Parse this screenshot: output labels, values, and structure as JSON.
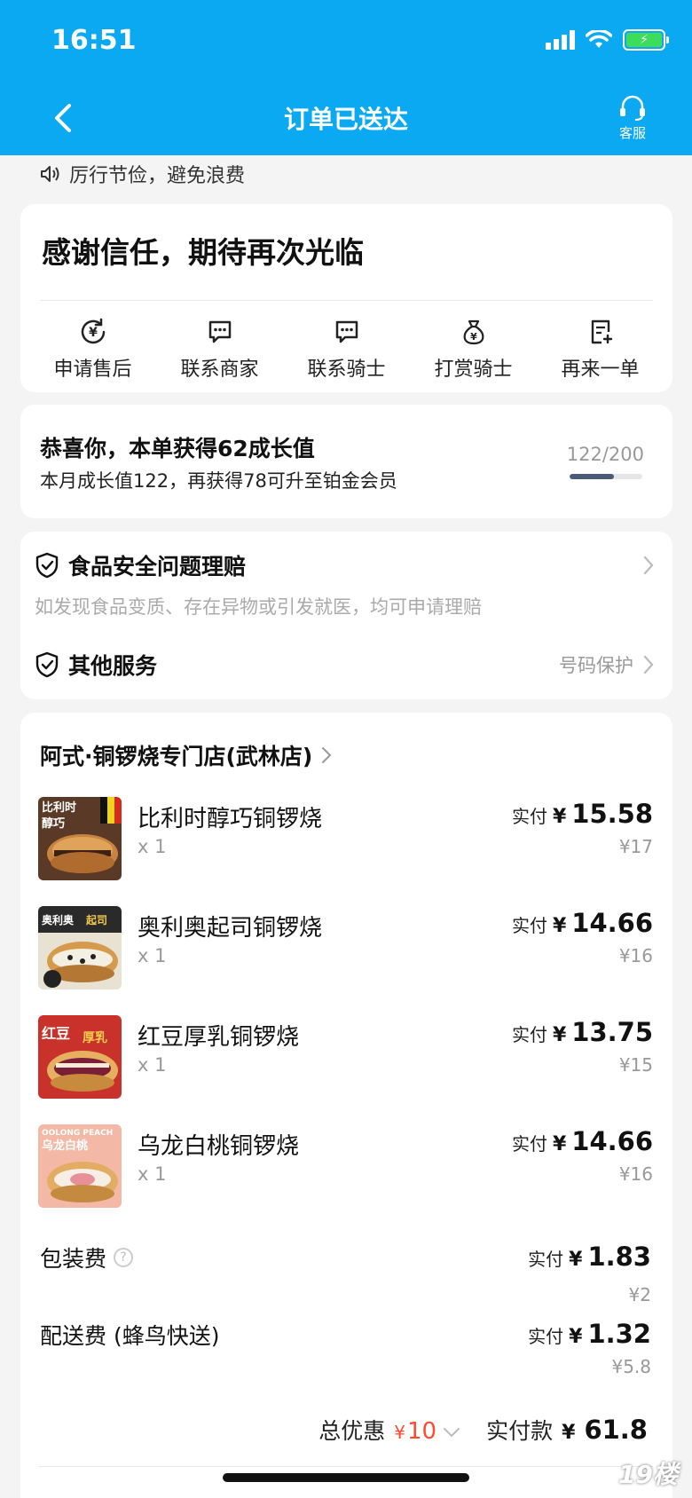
{
  "status_bar": {
    "time": "16:51"
  },
  "nav": {
    "title": "订单已送达",
    "service_label": "客服"
  },
  "notice": "厉行节俭，避免浪费",
  "thanks_card": {
    "title": "感谢信任，期待再次光临",
    "actions": [
      {
        "label": "申请售后",
        "icon": "refund-icon"
      },
      {
        "label": "联系商家",
        "icon": "chat-icon"
      },
      {
        "label": "联系骑士",
        "icon": "chat-icon"
      },
      {
        "label": "打赏骑士",
        "icon": "money-bag-icon"
      },
      {
        "label": "再来一单",
        "icon": "reorder-icon"
      }
    ]
  },
  "growth": {
    "title": "恭喜你，本单获得62成长值",
    "subtitle": "本月成长值122，再获得78可升至铂金会员",
    "progress_text": "122/200",
    "progress_fraction": 0.61
  },
  "services": {
    "food_safety": {
      "title": "食品安全问题理赔",
      "desc": "如发现食品变质、存在异物或引发就医，均可申请理赔"
    },
    "other": {
      "title": "其他服务",
      "right": "号码保护"
    }
  },
  "order": {
    "shop_name": "阿式·铜锣烧专门店(武林店)",
    "paid_label": "实付",
    "currency": "¥",
    "items": [
      {
        "name": "比利时醇巧铜锣烧",
        "qty": "x 1",
        "paid": "15.58",
        "orig": "¥17",
        "thumb_text": "比利时醇巧"
      },
      {
        "name": "奥利奥起司铜锣烧",
        "qty": "x 1",
        "paid": "14.66",
        "orig": "¥16",
        "thumb_text": "奥利奥起司"
      },
      {
        "name": "红豆厚乳铜锣烧",
        "qty": "x 1",
        "paid": "13.75",
        "orig": "¥15",
        "thumb_text": "红豆厚乳"
      },
      {
        "name": "乌龙白桃铜锣烧",
        "qty": "x 1",
        "paid": "14.66",
        "orig": "¥16",
        "thumb_text": "OOLONG PEACH 乌龙白桃"
      }
    ],
    "packaging": {
      "label": "包装费",
      "paid": "1.83",
      "orig": "¥2"
    },
    "delivery": {
      "label": "配送费 (蜂鸟快送)",
      "paid": "1.32",
      "orig": "¥5.8"
    },
    "total": {
      "discount_label": "总优惠",
      "discount": "10",
      "pay_label": "实付款",
      "pay": "61.8"
    }
  },
  "watermark": "19楼"
}
